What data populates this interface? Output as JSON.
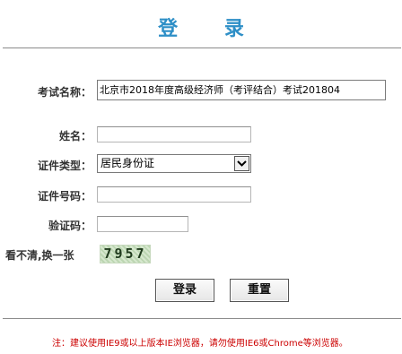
{
  "page": {
    "title": "登 录"
  },
  "form": {
    "exam_name_label": "考试名称：",
    "exam_name_value": "北京市2018年度高级经济师（考评结合）考试201804",
    "name_label": "姓名：",
    "name_value": "",
    "id_type_label": "证件类型：",
    "id_type_selected": "居民身份证",
    "id_number_label": "证件号码：",
    "id_number_value": "",
    "captcha_label": "验证码：",
    "captcha_value": "",
    "refresh_label": "看不清,换一张",
    "captcha_text": "7957"
  },
  "buttons": {
    "login": "登录",
    "reset": "重置"
  },
  "note": "注：建议使用IE9或以上版本IE浏览器，请勿使用IE6或Chrome等浏览器。",
  "colors": {
    "title": "#2e8fc7",
    "note": "#cc0000"
  }
}
